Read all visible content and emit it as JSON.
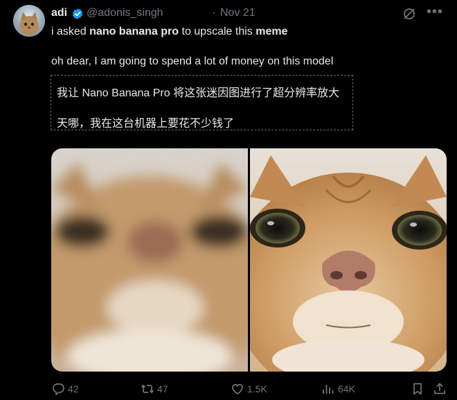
{
  "post": {
    "author_name": "adi",
    "handle": "@adonis_singh",
    "separator": "·",
    "date": "Nov 21",
    "text_line1": {
      "part1": "i asked ",
      "bold1": "nano banana pro",
      "part2": " to upscale this ",
      "bold2": "meme"
    },
    "text_line2": "oh dear, I am going to spend a lot of money on this model",
    "translation": {
      "line1": "我让 Nano Banana Pro 将这张迷因图进行了超分辨率放大",
      "line2": "天哪，我在这台机器上要花不少钱了"
    }
  },
  "actions": {
    "replies": "42",
    "reposts": "47",
    "likes": "1.5K",
    "views": "64K"
  },
  "icons": [
    "verified-badge-icon",
    "grok-icon",
    "more-icon",
    "reply-icon",
    "repost-icon",
    "like-icon",
    "views-icon",
    "bookmark-icon",
    "share-icon"
  ],
  "colors": {
    "background": "#000000",
    "text": "#e7e9ea",
    "muted": "#71767b",
    "verified": "#1d9bf0"
  }
}
